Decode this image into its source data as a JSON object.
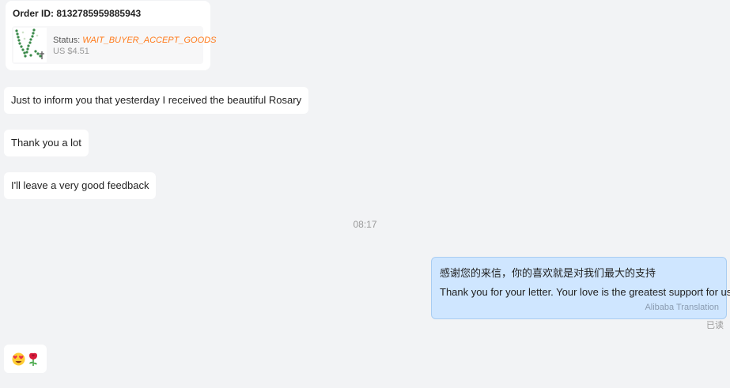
{
  "order": {
    "id_label": "Order ID: 8132785959885943",
    "status_label": "Status: ",
    "status_value": "WAIT_BUYER_ACCEPT_GOODS",
    "price": "US $4.51",
    "thumbnail_icon": "rosary-image-icon"
  },
  "messages": [
    {
      "text": "Just to inform you that yesterday I received the beautiful Rosary"
    },
    {
      "text": "Thank you a lot"
    },
    {
      "text": "I'll leave a very good feedback"
    }
  ],
  "timestamp": "08:17",
  "reply": {
    "original": "感谢您的来信，你的喜欢就是对我们最大的支持",
    "translated": "Thank you for your letter. Your love is the greatest support for us.",
    "translation_label": "Alibaba Translation",
    "read_status": "已读"
  },
  "emoji_message": {
    "icons": [
      "heart-eyes-emoji-icon",
      "rose-emoji-icon"
    ]
  },
  "colors": {
    "background": "#f2f3f5",
    "status_orange": "#ff7a1a",
    "outgoing_bubble": "#cfe6ff"
  }
}
